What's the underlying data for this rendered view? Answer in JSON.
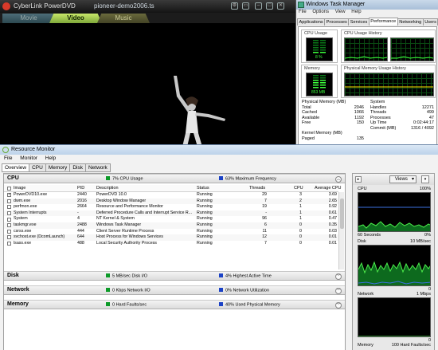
{
  "powerdvd": {
    "brand": "CyberLink PowerDVD",
    "file": "pioneer-demo2006.ts",
    "tabs": [
      "Movie",
      "Video",
      "Music"
    ],
    "active_tab": "Video"
  },
  "taskmgr": {
    "title": "Windows Task Manager",
    "menu": [
      "File",
      "Options",
      "View",
      "Help"
    ],
    "tabs": [
      "Applications",
      "Processes",
      "Services",
      "Performance",
      "Networking",
      "Users"
    ],
    "active_tab": "Performance",
    "cpu_usage_label": "CPU Usage",
    "cpu_usage_value": "8 %",
    "cpu_history_label": "CPU Usage History",
    "memory_label": "Memory",
    "memory_value": "853 MB",
    "phys_history_label": "Physical Memory Usage History",
    "phys_mem": {
      "label": "Physical Memory (MB)",
      "rows": [
        {
          "k": "Total",
          "v": "2046"
        },
        {
          "k": "Cached",
          "v": "1066"
        },
        {
          "k": "Available",
          "v": "1192"
        },
        {
          "k": "Free",
          "v": "150"
        }
      ]
    },
    "system": {
      "label": "System",
      "rows": [
        {
          "k": "Handles",
          "v": "12271"
        },
        {
          "k": "Threads",
          "v": "499"
        },
        {
          "k": "Processes",
          "v": "47"
        },
        {
          "k": "Up Time",
          "v": "0:02:44:17"
        },
        {
          "k": "Commit (MB)",
          "v": "1316 / 4092"
        }
      ]
    },
    "kernel": {
      "label": "Kernel Memory (MB)",
      "rows": [
        {
          "k": "Paged",
          "v": "135"
        }
      ]
    }
  },
  "resmon": {
    "title": "Resource Monitor",
    "menu": [
      "File",
      "Monitor",
      "Help"
    ],
    "tabs": [
      "Overview",
      "CPU",
      "Memory",
      "Disk",
      "Network"
    ],
    "active_tab": "Overview",
    "sections": {
      "cpu": {
        "name": "CPU",
        "s1": "7% CPU Usage",
        "s2": "63% Maximum Frequency"
      },
      "disk": {
        "name": "Disk",
        "s1": "5 MB/sec Disk I/O",
        "s2": "4% Highest Active Time"
      },
      "network": {
        "name": "Network",
        "s1": "0 Kbps Network I/O",
        "s2": "0% Network Utilization"
      },
      "memory": {
        "name": "Memory",
        "s1": "0 Hard Faults/sec",
        "s2": "40% Used Physical Memory"
      }
    },
    "columns": {
      "image": "Image",
      "pid": "PID",
      "description": "Description",
      "status": "Status",
      "threads": "Threads",
      "cpu": "CPU",
      "avg_cpu": "Average CPU"
    },
    "processes": [
      {
        "checked": true,
        "image": "PowerDVD10.exe",
        "pid": "2440",
        "description": "PowerDVD 10.0",
        "status": "Running",
        "threads": "29",
        "cpu": "3",
        "avg": "3.69"
      },
      {
        "checked": false,
        "image": "dwm.exe",
        "pid": "2016",
        "description": "Desktop Window Manager",
        "status": "Running",
        "threads": "7",
        "cpu": "2",
        "avg": "2.65"
      },
      {
        "checked": false,
        "image": "perfmon.exe",
        "pid": "2664",
        "description": "Resource and Performance Monitor",
        "status": "Running",
        "threads": "19",
        "cpu": "1",
        "avg": "0.92"
      },
      {
        "checked": false,
        "image": "System Interrupts",
        "pid": "-",
        "description": "Deferred Procedure Calls and Interrupt Service R...",
        "status": "Running",
        "threads": "-",
        "cpu": "1",
        "avg": "0.61"
      },
      {
        "checked": false,
        "image": "System",
        "pid": "4",
        "description": "NT Kernel & System",
        "status": "Running",
        "threads": "96",
        "cpu": "1",
        "avg": "0.47"
      },
      {
        "checked": false,
        "image": "taskmgr.exe",
        "pid": "2488",
        "description": "Windows Task Manager",
        "status": "Running",
        "threads": "6",
        "cpu": "0",
        "avg": "0.35"
      },
      {
        "checked": false,
        "image": "csrss.exe",
        "pid": "444",
        "description": "Client Server Runtime Process",
        "status": "Running",
        "threads": "11",
        "cpu": "0",
        "avg": "0.03"
      },
      {
        "checked": false,
        "image": "svchost.exe (DcomLaunch)",
        "pid": "644",
        "description": "Host Process for Windows Services",
        "status": "Running",
        "threads": "12",
        "cpu": "0",
        "avg": "0.01"
      },
      {
        "checked": false,
        "image": "lsass.exe",
        "pid": "488",
        "description": "Local Security Authority Process",
        "status": "Running",
        "threads": "7",
        "cpu": "0",
        "avg": "0.01"
      }
    ],
    "right": {
      "views": "Views",
      "graphs": [
        {
          "title": "CPU",
          "max": "100%",
          "foot_l": "60 Seconds",
          "foot_r": "0%"
        },
        {
          "title": "Disk",
          "max": "10 MB/sec",
          "foot_l": "",
          "foot_r": "0"
        },
        {
          "title": "Network",
          "max": "1 Mbps",
          "foot_l": "",
          "foot_r": "0"
        },
        {
          "title": "Memory",
          "max": "100 Hard Faults/sec",
          "foot_l": "",
          "foot_r": ""
        }
      ]
    }
  }
}
